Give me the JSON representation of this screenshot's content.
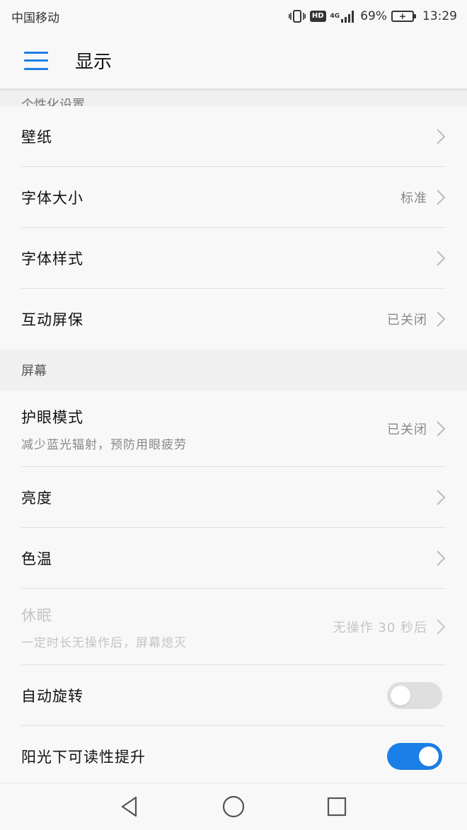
{
  "status": {
    "carrier": "中国移动",
    "hd": "HD",
    "network": "4G",
    "battery_percent": "69%",
    "time": "13:29",
    "icons": [
      "vibrate-icon",
      "hd-icon",
      "signal-icon",
      "battery-icon"
    ]
  },
  "appbar": {
    "title": "显示",
    "menu_icon": "menu-icon"
  },
  "sections": {
    "personalize_header": "个性化设置",
    "screen_header": "屏幕"
  },
  "rows": {
    "wallpaper": {
      "title": "壁纸"
    },
    "font_size": {
      "title": "字体大小",
      "value": "标准"
    },
    "font_style": {
      "title": "字体样式"
    },
    "screensaver": {
      "title": "互动屏保",
      "value": "已关闭"
    },
    "eye_comfort": {
      "title": "护眼模式",
      "subtitle": "减少蓝光辐射，预防用眼疲劳",
      "value": "已关闭"
    },
    "brightness": {
      "title": "亮度"
    },
    "color_temp": {
      "title": "色温"
    },
    "sleep": {
      "title": "休眠",
      "subtitle": "一定时长无操作后，屏幕熄灭",
      "value": "无操作 30 秒后"
    },
    "auto_rotate": {
      "title": "自动旋转",
      "enabled": false
    },
    "sunlight_readability": {
      "title": "阳光下可读性提升",
      "enabled": true
    }
  },
  "colors": {
    "accent": "#1a7fe6",
    "toggle_off": "#dedede",
    "background": "#f8f8f8",
    "section_bg": "#f0f0f0"
  },
  "navbar": {
    "icons": [
      "back-icon",
      "home-icon",
      "recents-icon"
    ]
  }
}
